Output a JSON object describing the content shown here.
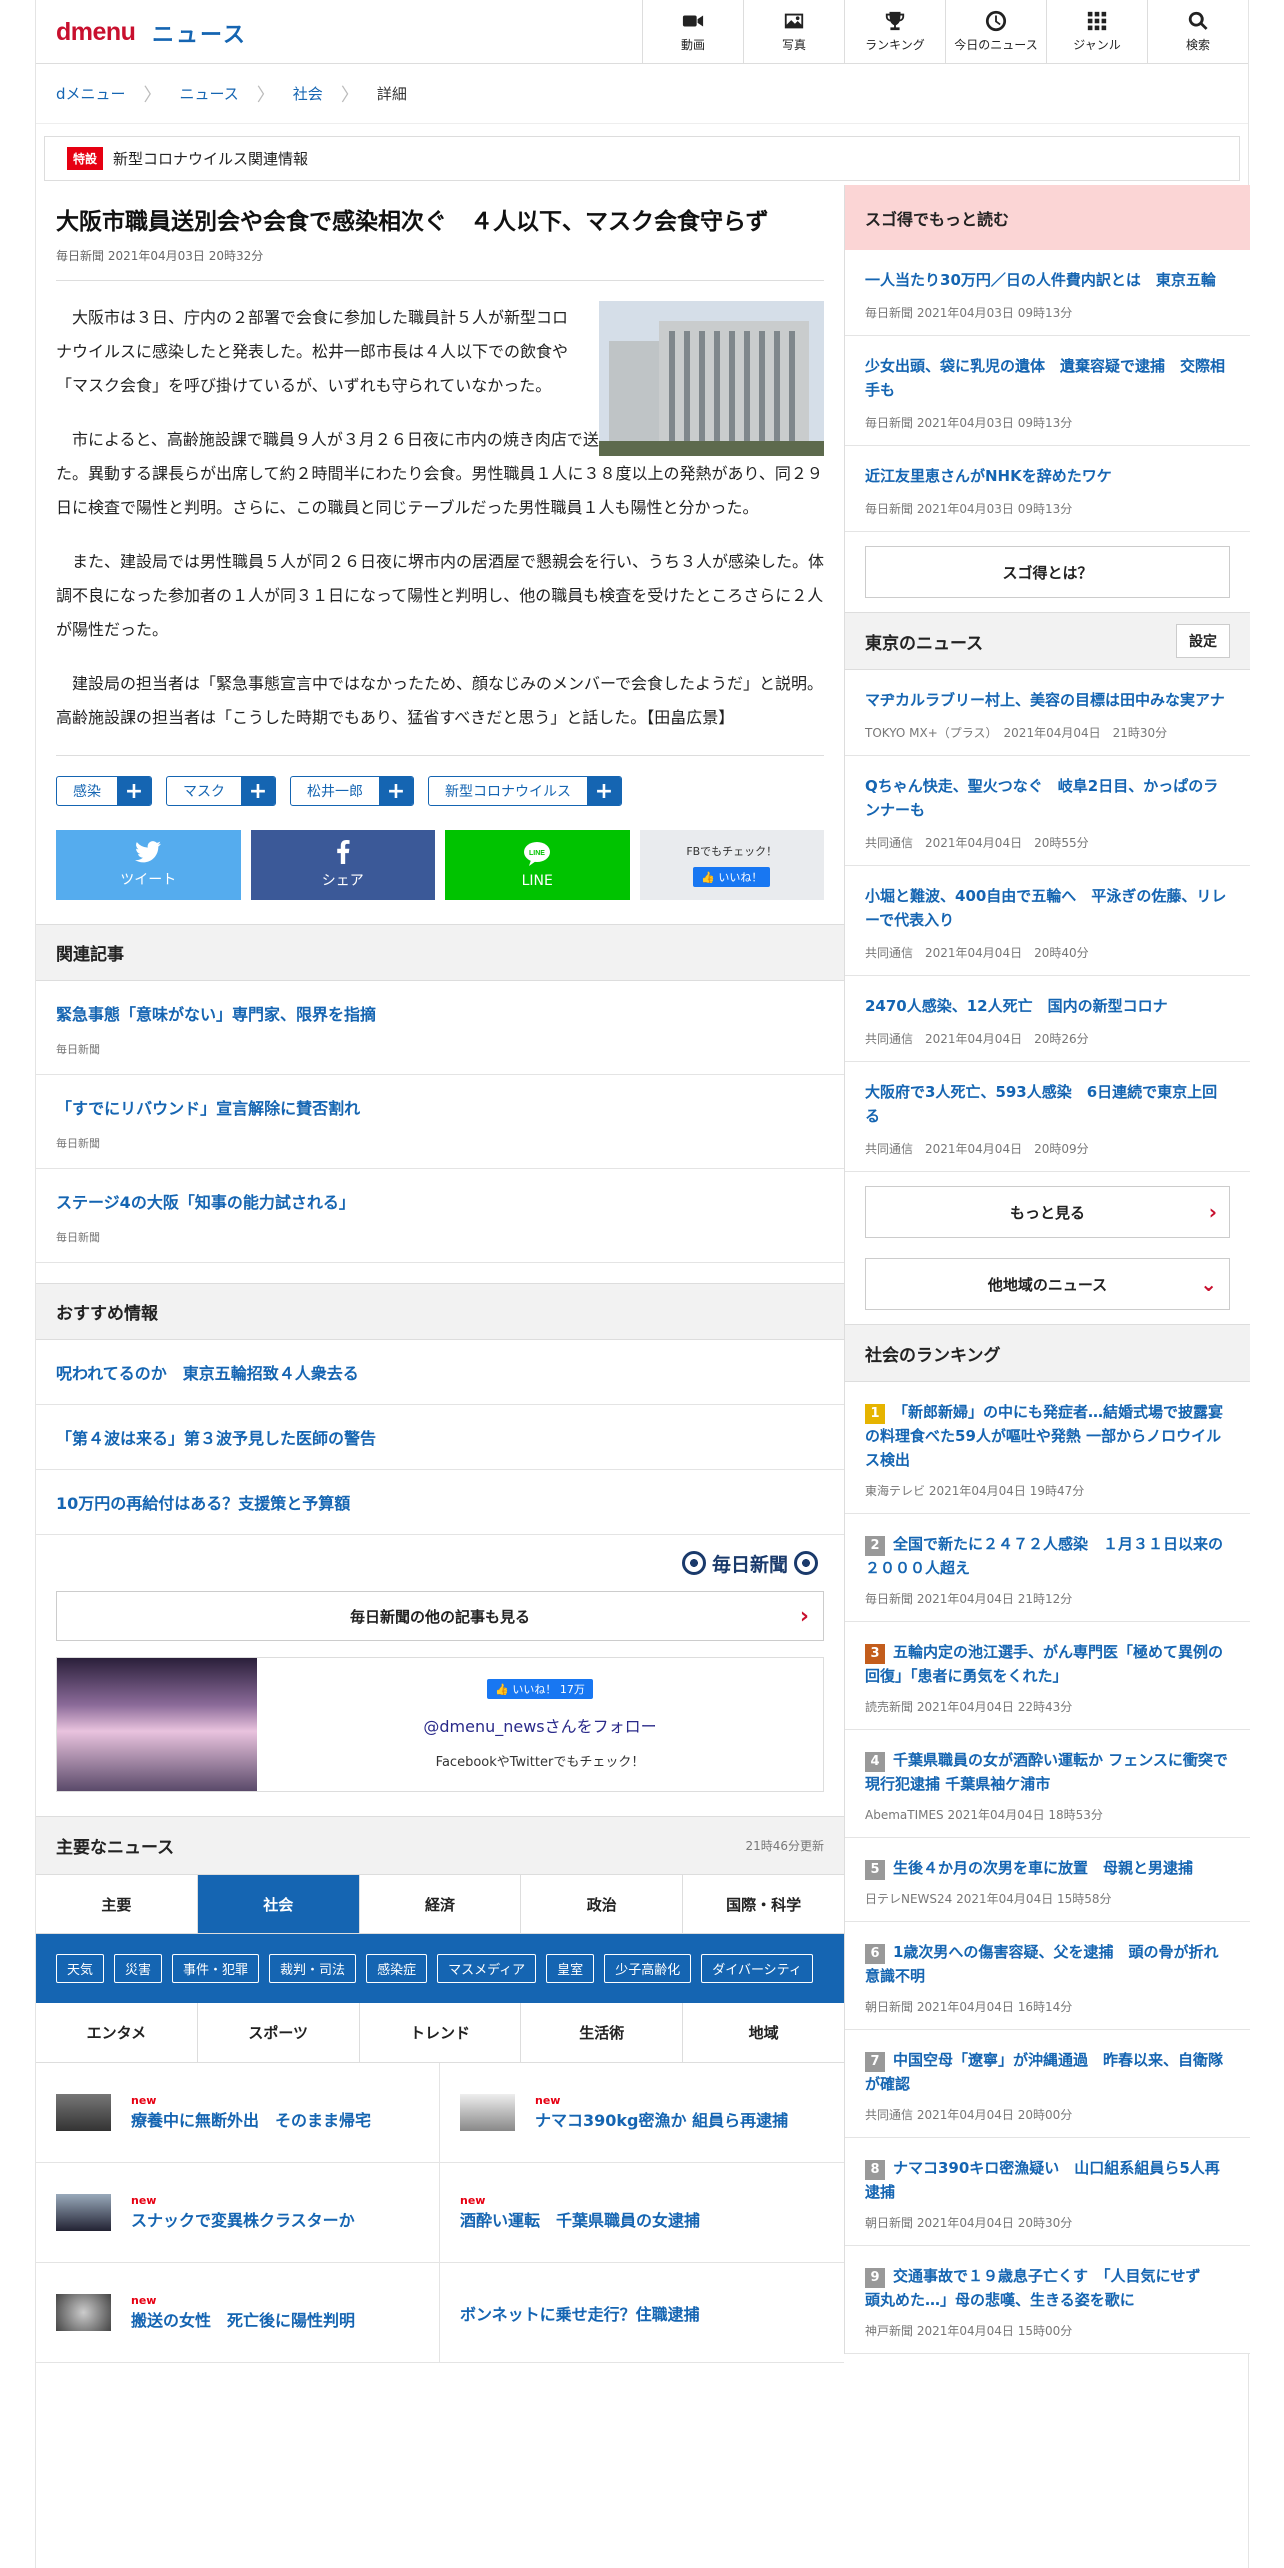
{
  "header": {
    "logo": "dmenu",
    "site_name": "ニュース",
    "nav": [
      {
        "label": "動画",
        "icon": "video-icon"
      },
      {
        "label": "写真",
        "icon": "photo-icon"
      },
      {
        "label": "ランキング",
        "icon": "trophy-icon"
      },
      {
        "label": "今日のニュース",
        "icon": "clock-icon"
      },
      {
        "label": "ジャンル",
        "icon": "grid-icon"
      },
      {
        "label": "検索",
        "icon": "search-icon"
      }
    ]
  },
  "breadcrumb": [
    "dメニュー",
    "ニュース",
    "社会",
    "詳細"
  ],
  "special": {
    "badge": "特設",
    "text": "新型コロナウイルス関連情報"
  },
  "article": {
    "title": "大阪市職員送別会や会食で感染相次ぐ　４人以下、マスク会食守らず",
    "meta": "毎日新聞 2021年04月03日 20時32分",
    "paragraphs": [
      "大阪市は３日、庁内の２部署で会食に参加した職員計５人が新型コロナウイルスに感染したと発表した。松井一郎市長は４人以下での飲食や「マスク会食」を呼び掛けているが、いずれも守られていなかった。",
      "市によると、高齢施設課で職員９人が３月２６日夜に市内の焼き肉店で送別会を開き、うち２人が感染した。異動する課長らが出席して約２時間半にわたり会食。男性職員１人に３８度以上の発熱があり、同２９日に検査で陽性と判明。さらに、この職員と同じテーブルだった男性職員１人も陽性と分かった。",
      "また、建設局では男性職員５人が同２６日夜に堺市内の居酒屋で懇親会を行い、うち３人が感染した。体調不良になった参加者の１人が同３１日になって陽性と判明し、他の職員も検査を受けたところさらに２人が陽性だった。",
      "建設局の担当者は「緊急事態宣言中ではなかったため、顔なじみのメンバーで会食したようだ」と説明。高齢施設課の担当者は「こうした時期でもあり、猛省すべきだと思う」と話した。【田畠広景】"
    ],
    "tags": [
      "感染",
      "マスク",
      "松井一郎",
      "新型コロナウイルス"
    ],
    "share": {
      "tweet": "ツイート",
      "share": "シェア",
      "line": "LINE",
      "fb_check": "FBでもチェック！",
      "like": "いいね！"
    }
  },
  "related": {
    "heading": "関連記事",
    "items": [
      {
        "title": "緊急事態「意味がない」専門家、限界を指摘",
        "source": "毎日新聞"
      },
      {
        "title": "「すでにリバウンド」宣言解除に賛否割れ",
        "source": "毎日新聞"
      },
      {
        "title": "ステージ4の大阪「知事の能力試される」",
        "source": "毎日新聞"
      }
    ]
  },
  "recommend": {
    "heading": "おすすめ情報",
    "items": [
      "呪われてるのか　東京五輪招致４人衆去る",
      "「第４波は来る」第３波予見した医師の警告",
      "10万円の再給付はある？支援策と予算額"
    ]
  },
  "mainichi": {
    "logo": "毎日新聞",
    "more": "毎日新聞の他の記事も見る"
  },
  "follow": {
    "like": "いいね！ 17万",
    "account": "@dmenu_newsさんをフォロー",
    "sub": "FacebookやTwitterでもチェック！"
  },
  "major": {
    "heading": "主要なニュース",
    "updated": "21時46分更新",
    "tabs_row1": [
      "主要",
      "社会",
      "経済",
      "政治",
      "国際・科学"
    ],
    "subtags": [
      "天気",
      "災害",
      "事件・犯罪",
      "裁判・司法",
      "感染症",
      "マスメディア",
      "皇室",
      "少子高齢化",
      "ダイバーシティ"
    ],
    "tabs_row2": [
      "エンタメ",
      "スポーツ",
      "トレンド",
      "生活術",
      "地域"
    ],
    "news": [
      {
        "title": "療養中に無断外出　そのまま帰宅",
        "new": "new"
      },
      {
        "title": "ナマコ390kg密漁か 組員ら再逮捕",
        "new": "new"
      },
      {
        "title": "スナックで変異株クラスターか",
        "new": "new"
      },
      {
        "title": "酒酔い運転　千葉県職員の女逮捕",
        "new": "new"
      },
      {
        "title": "搬送の女性　死亡後に陽性判明",
        "new": "new"
      },
      {
        "title": "ボンネットに乗せ走行？住職逮捕",
        "new": ""
      }
    ]
  },
  "sidebar": {
    "sugotoku_heading": "スゴ得でもっと読む",
    "sugotoku": [
      {
        "title": "一人当たり30万円／日の人件費内訳とは　東京五輪",
        "source": "毎日新聞 2021年04月03日 09時13分"
      },
      {
        "title": "少女出頭、袋に乳児の遺体　遺棄容疑で逮捕　交際相手も",
        "source": "毎日新聞 2021年04月03日 09時13分"
      },
      {
        "title": "近江友里恵さんがNHKを辞めたワケ",
        "source": "毎日新聞 2021年04月03日 09時13分"
      }
    ],
    "sugotoku_btn": "スゴ得とは？",
    "tokyo_heading": "東京のニュース",
    "tokyo_setting": "設定",
    "tokyo": [
      {
        "title": "マヂカルラブリー村上、美容の目標は田中みな実アナ",
        "source": "TOKYO MX+（プラス）　2021年04月04日　21時30分"
      },
      {
        "title": "Qちゃん快走、聖火つなぐ　岐阜2日目、かっぱのランナーも",
        "source": "共同通信　2021年04月04日　20時55分"
      },
      {
        "title": "小堀と難波、400自由で五輪へ　平泳ぎの佐藤、リレーで代表入り",
        "source": "共同通信　2021年04月04日　20時40分"
      },
      {
        "title": "2470人感染、12人死亡　国内の新型コロナ",
        "source": "共同通信　2021年04月04日　20時26分"
      },
      {
        "title": "大阪府で3人死亡、593人感染　6日連続で東京上回る",
        "source": "共同通信　2021年04月04日　20時09分"
      }
    ],
    "tokyo_more": "もっと見る",
    "tokyo_other": "他地域のニュース",
    "ranking_heading": "社会のランキング",
    "ranking": [
      {
        "num": "1",
        "title": "「新郎新婦」の中にも発症者…結婚式場で披露宴の料理食べた59人が嘔吐や発熱 一部からノロウイルス検出",
        "source": "東海テレビ 2021年04月04日 19時47分"
      },
      {
        "num": "2",
        "title": "全国で新たに２４７２人感染　１月３１日以来の２０００人超え",
        "source": "毎日新聞 2021年04月04日 21時12分"
      },
      {
        "num": "3",
        "title": "五輪内定の池江選手、がん専門医「極めて異例の回復」「患者に勇気をくれた」",
        "source": "読売新聞 2021年04月04日 22時43分"
      },
      {
        "num": "4",
        "title": "千葉県職員の女が酒酔い運転か フェンスに衝突で現行犯逮捕 千葉県袖ケ浦市",
        "source": "AbemaTIMES 2021年04月04日 18時53分"
      },
      {
        "num": "5",
        "title": "生後４か月の次男を車に放置　母親と男逮捕",
        "source": "日テレNEWS24 2021年04月04日 15時58分"
      },
      {
        "num": "6",
        "title": "1歳次男への傷害容疑、父を逮捕　頭の骨が折れ意識不明",
        "source": "朝日新聞 2021年04月04日 16時14分"
      },
      {
        "num": "7",
        "title": "中国空母「遼寧」が沖縄通過　昨春以来、自衛隊が確認",
        "source": "共同通信 2021年04月04日 20時00分"
      },
      {
        "num": "8",
        "title": "ナマコ390キロ密漁疑い　山口組系組員ら5人再逮捕",
        "source": "朝日新聞 2021年04月04日 20時30分"
      },
      {
        "num": "9",
        "title": "交通事故で１９歳息子亡くす　「人目気にせず　頭丸めた…」母の悲嘆、生きる姿を歌に",
        "source": "神戸新聞 2021年04月04日 15時00分"
      }
    ]
  }
}
